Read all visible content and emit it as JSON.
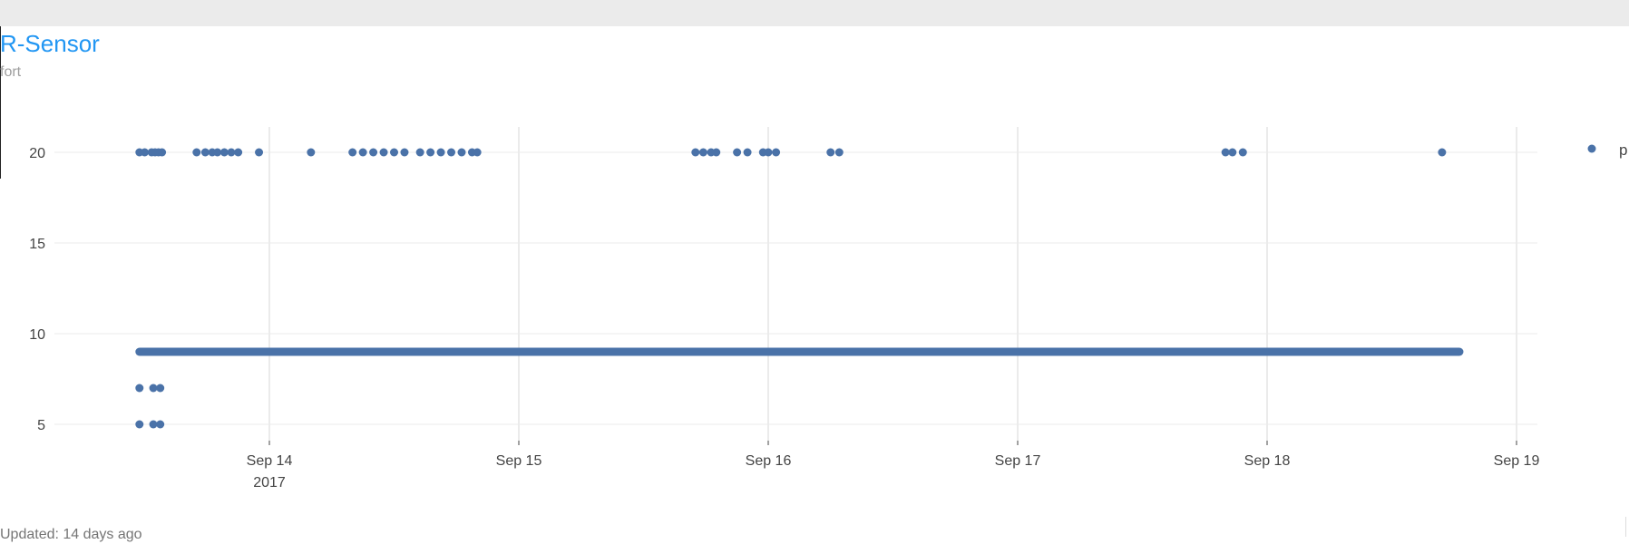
{
  "header": {
    "title": "R-Sensor",
    "subtitle": "fort"
  },
  "footer": {
    "updated": "Updated: 14 days ago"
  },
  "colors": {
    "topbar": "#ebebeb",
    "title": "#2196f3",
    "marker": "#4a72a8",
    "grid": "#ebebeb"
  },
  "chart_data": {
    "type": "scatter",
    "title": "R-Sensor",
    "subtitle": "fort",
    "xlabel": "",
    "ylabel": "",
    "grid": true,
    "legend": {
      "placement": "right",
      "entries": [
        "p"
      ]
    },
    "xlim": [
      "2017-09-13T00:00",
      "2017-09-19T00:00"
    ],
    "ylim": [
      5,
      20
    ],
    "y_ticks": [
      5,
      10,
      15,
      20
    ],
    "x_ticks": [
      {
        "date": "2017-09-14",
        "label": "Sep 14",
        "sublabel": "2017"
      },
      {
        "date": "2017-09-15",
        "label": "Sep 15"
      },
      {
        "date": "2017-09-16",
        "label": "Sep 16"
      },
      {
        "date": "2017-09-17",
        "label": "Sep 17"
      },
      {
        "date": "2017-09-18",
        "label": "Sep 18"
      },
      {
        "date": "2017-09-19",
        "label": "Sep 19"
      }
    ],
    "series": [
      {
        "name": "p",
        "constant_run": {
          "y": 9,
          "x_start": "2017-09-13T11:30",
          "x_end": "2017-09-18T18:30"
        },
        "points": [
          {
            "x": "2017-09-13T11:30",
            "y": 5
          },
          {
            "x": "2017-09-13T12:50",
            "y": 5
          },
          {
            "x": "2017-09-13T13:30",
            "y": 5
          },
          {
            "x": "2017-09-13T11:30",
            "y": 7
          },
          {
            "x": "2017-09-13T12:50",
            "y": 7
          },
          {
            "x": "2017-09-13T13:30",
            "y": 7
          },
          {
            "x": "2017-09-13T11:30",
            "y": 20
          },
          {
            "x": "2017-09-13T12:00",
            "y": 20
          },
          {
            "x": "2017-09-13T12:40",
            "y": 20
          },
          {
            "x": "2017-09-13T13:00",
            "y": 20
          },
          {
            "x": "2017-09-13T13:20",
            "y": 20
          },
          {
            "x": "2017-09-13T13:40",
            "y": 20
          },
          {
            "x": "2017-09-13T17:00",
            "y": 20
          },
          {
            "x": "2017-09-13T17:50",
            "y": 20
          },
          {
            "x": "2017-09-13T18:30",
            "y": 20
          },
          {
            "x": "2017-09-13T19:00",
            "y": 20
          },
          {
            "x": "2017-09-13T19:40",
            "y": 20
          },
          {
            "x": "2017-09-13T20:20",
            "y": 20
          },
          {
            "x": "2017-09-13T21:00",
            "y": 20
          },
          {
            "x": "2017-09-13T23:00",
            "y": 20
          },
          {
            "x": "2017-09-14T04:00",
            "y": 20
          },
          {
            "x": "2017-09-14T08:00",
            "y": 20
          },
          {
            "x": "2017-09-14T09:00",
            "y": 20
          },
          {
            "x": "2017-09-14T10:00",
            "y": 20
          },
          {
            "x": "2017-09-14T11:00",
            "y": 20
          },
          {
            "x": "2017-09-14T12:00",
            "y": 20
          },
          {
            "x": "2017-09-14T13:00",
            "y": 20
          },
          {
            "x": "2017-09-14T14:30",
            "y": 20
          },
          {
            "x": "2017-09-14T15:30",
            "y": 20
          },
          {
            "x": "2017-09-14T16:30",
            "y": 20
          },
          {
            "x": "2017-09-14T17:30",
            "y": 20
          },
          {
            "x": "2017-09-14T18:30",
            "y": 20
          },
          {
            "x": "2017-09-14T19:30",
            "y": 20
          },
          {
            "x": "2017-09-14T20:00",
            "y": 20
          },
          {
            "x": "2017-09-15T17:00",
            "y": 20
          },
          {
            "x": "2017-09-15T17:45",
            "y": 20
          },
          {
            "x": "2017-09-15T18:30",
            "y": 20
          },
          {
            "x": "2017-09-15T19:00",
            "y": 20
          },
          {
            "x": "2017-09-15T21:00",
            "y": 20
          },
          {
            "x": "2017-09-15T22:00",
            "y": 20
          },
          {
            "x": "2017-09-15T23:30",
            "y": 20
          },
          {
            "x": "2017-09-16T00:00",
            "y": 20
          },
          {
            "x": "2017-09-16T00:45",
            "y": 20
          },
          {
            "x": "2017-09-16T06:00",
            "y": 20
          },
          {
            "x": "2017-09-16T06:50",
            "y": 20
          },
          {
            "x": "2017-09-17T20:00",
            "y": 20
          },
          {
            "x": "2017-09-17T20:40",
            "y": 20
          },
          {
            "x": "2017-09-17T21:40",
            "y": 20
          },
          {
            "x": "2017-09-18T16:50",
            "y": 20
          }
        ]
      }
    ]
  }
}
